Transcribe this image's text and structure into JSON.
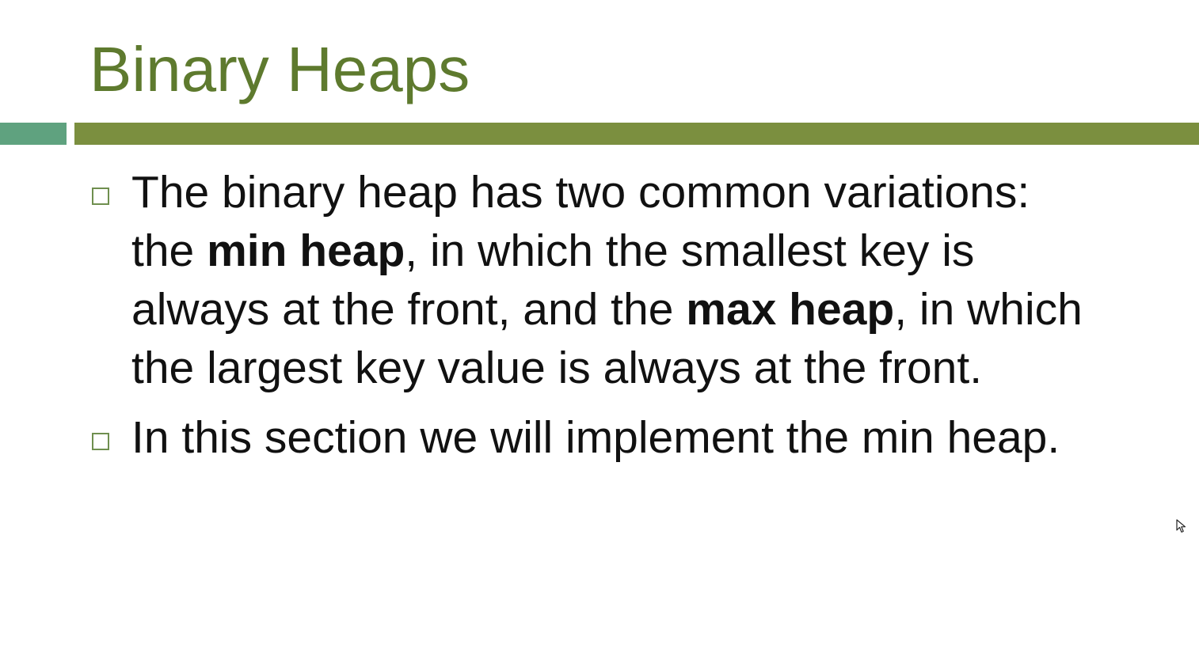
{
  "slide": {
    "title": "Binary Heaps",
    "colors": {
      "title": "#5e7a2e",
      "bar_left": "#5fa27f",
      "bar_main": "#7b8f3f",
      "bullet_marker": "#6f8f4f",
      "text": "#111111"
    },
    "bullets": [
      {
        "marker_icon": "hollow-square-bullet-icon",
        "parts": [
          {
            "text": "The binary heap has two common variations: the ",
            "bold": false
          },
          {
            "text": "min heap",
            "bold": true
          },
          {
            "text": ", in which the smallest key is always at the front, and the ",
            "bold": false
          },
          {
            "text": "max heap",
            "bold": true
          },
          {
            "text": ", in which the largest key value is always at the front.",
            "bold": false
          }
        ]
      },
      {
        "marker_icon": "hollow-square-bullet-icon",
        "parts": [
          {
            "text": "In this section we will implement the min heap.",
            "bold": false
          }
        ]
      }
    ]
  },
  "cursor_icon": "mouse-pointer-icon"
}
